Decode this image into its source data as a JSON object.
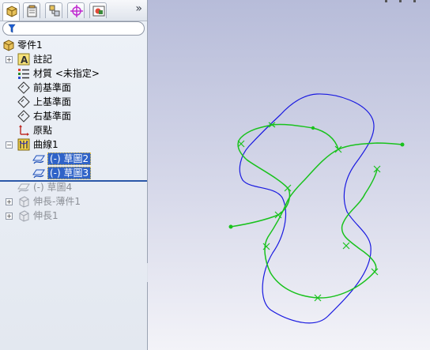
{
  "tabs": [
    {
      "name": "feature-manager"
    },
    {
      "name": "property-manager"
    },
    {
      "name": "configuration-manager"
    },
    {
      "name": "dim-xpert-manager"
    },
    {
      "name": "display-manager"
    }
  ],
  "toolbar": {
    "more_label": "»"
  },
  "filter": {
    "value": ""
  },
  "tree": {
    "part": "零件1",
    "annotations": "註記",
    "material": "材質 <未指定>",
    "front_plane": "前基準面",
    "top_plane": "上基準面",
    "right_plane": "右基準面",
    "origin": "原點",
    "curve": "曲線1",
    "sketch2": "(-) 草圖2",
    "sketch3": "(-) 草圖3",
    "sketch4": "(-) 草圖4",
    "extrude_thin": "伸長-薄件1",
    "extrude": "伸長1"
  },
  "colors": {
    "blue_curve": "#1a1ae0",
    "green_curve": "#19c21d",
    "selection": "#2f63c8",
    "rollback_bar": "#2b58a8"
  }
}
